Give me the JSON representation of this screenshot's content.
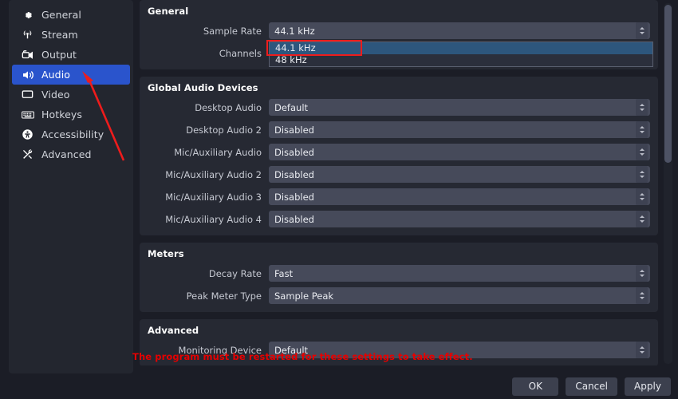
{
  "sidebar": {
    "items": [
      {
        "label": "General",
        "icon": "gear-icon",
        "selected": false
      },
      {
        "label": "Stream",
        "icon": "broadcast-icon",
        "selected": false
      },
      {
        "label": "Output",
        "icon": "video-camera-icon",
        "selected": false
      },
      {
        "label": "Audio",
        "icon": "speaker-icon",
        "selected": true
      },
      {
        "label": "Video",
        "icon": "monitor-icon",
        "selected": false
      },
      {
        "label": "Hotkeys",
        "icon": "keyboard-icon",
        "selected": false
      },
      {
        "label": "Accessibility",
        "icon": "accessibility-icon",
        "selected": false
      },
      {
        "label": "Advanced",
        "icon": "tools-icon",
        "selected": false
      }
    ]
  },
  "content": {
    "groups": [
      {
        "title": "General",
        "rows": [
          {
            "label": "Sample Rate",
            "value": "44.1 kHz",
            "open": true
          },
          {
            "label": "Channels",
            "value": "",
            "open": false
          }
        ]
      },
      {
        "title": "Global Audio Devices",
        "rows": [
          {
            "label": "Desktop Audio",
            "value": "Default"
          },
          {
            "label": "Desktop Audio 2",
            "value": "Disabled"
          },
          {
            "label": "Mic/Auxiliary Audio",
            "value": "Disabled"
          },
          {
            "label": "Mic/Auxiliary Audio 2",
            "value": "Disabled"
          },
          {
            "label": "Mic/Auxiliary Audio 3",
            "value": "Disabled"
          },
          {
            "label": "Mic/Auxiliary Audio 4",
            "value": "Disabled"
          }
        ]
      },
      {
        "title": "Meters",
        "rows": [
          {
            "label": "Decay Rate",
            "value": "Fast"
          },
          {
            "label": "Peak Meter Type",
            "value": "Sample Peak"
          }
        ]
      },
      {
        "title": "Advanced",
        "rows": [
          {
            "label": "Monitoring Device",
            "value": "Default"
          }
        ]
      }
    ]
  },
  "dropdown": {
    "options": [
      {
        "label": "44.1 kHz",
        "selected": true
      },
      {
        "label": "48 kHz",
        "selected": false
      }
    ]
  },
  "warning": {
    "text": "The program must be restarted for these settings to take effect."
  },
  "footer": {
    "buttons": [
      {
        "label": "OK"
      },
      {
        "label": "Cancel"
      },
      {
        "label": "Apply"
      }
    ]
  },
  "colors": {
    "accent_selected": "#2a54cc",
    "annotation_red": "#ee1c1c",
    "warning_red": "#e60000",
    "panel_bg": "#262933",
    "window_bg": "#1b1d26",
    "input_bg": "#464a5a",
    "dropdown_selected": "#2d567d"
  }
}
